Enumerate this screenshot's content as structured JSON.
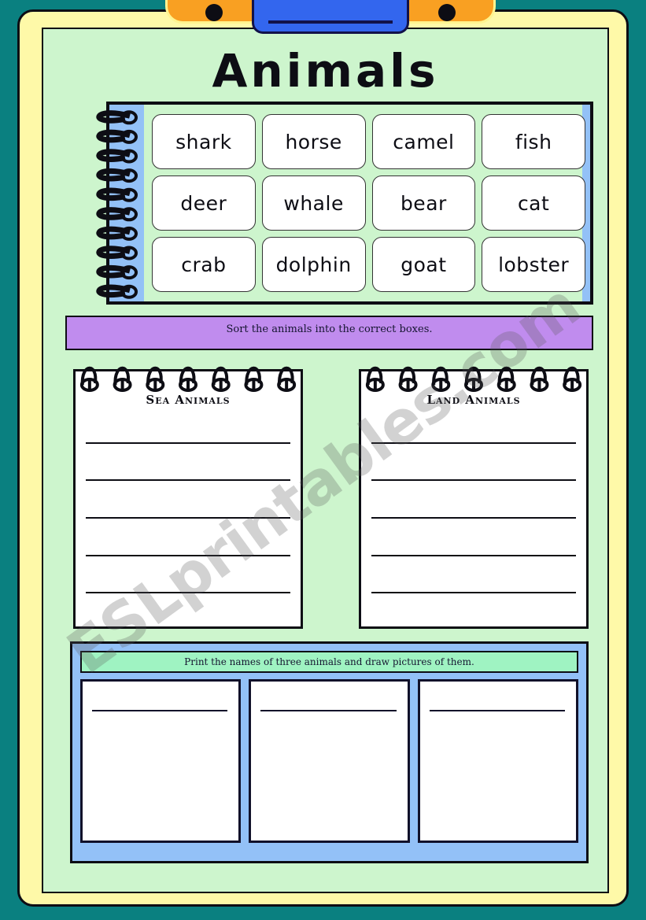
{
  "worksheet": {
    "title": "Animals",
    "name_tab_label": "",
    "watermark": "ESLprintables.com"
  },
  "header": {
    "punch_hole_left": "punch-hole-icon",
    "punch_hole_right": "punch-hole-icon",
    "name_blank": ""
  },
  "word_bank": {
    "words": [
      "shark",
      "horse",
      "camel",
      "fish",
      "deer",
      "whale",
      "bear",
      "cat",
      "crab",
      "dolphin",
      "goat",
      "lobster"
    ],
    "spiral_ring_count": 10
  },
  "instruction_sort": "Sort the animals into the correct boxes.",
  "sorting": {
    "columns": [
      {
        "heading": "Sea Animals",
        "line_count": 5,
        "ring_count": 7
      },
      {
        "heading": "Land Animals",
        "line_count": 5,
        "ring_count": 7
      }
    ]
  },
  "draw_section": {
    "instruction": "Print the names of three animals and draw pictures of them.",
    "box_count": 3
  },
  "colors": {
    "outer_background": "#0a8080",
    "frame": "#FEF9A8",
    "page": "#CDF5CD",
    "header_band": "#F9A022",
    "name_tab": "#3366EE",
    "binding_strip": "#93C1F7",
    "instruction_bar": "#C08CEE",
    "draw_panel": "#93C1F7",
    "draw_instruction_bar": "#9FF3C2",
    "ink": "#0d0d14"
  }
}
